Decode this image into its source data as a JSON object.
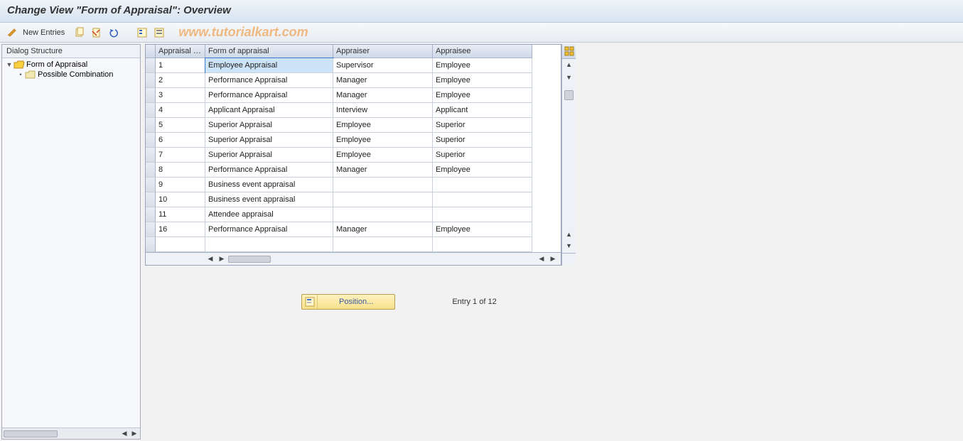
{
  "title": "Change View \"Form of Appraisal\": Overview",
  "toolbar": {
    "new_entries_label": "New Entries"
  },
  "watermark": "www.tutorialkart.com",
  "tree": {
    "header": "Dialog Structure",
    "items": [
      {
        "label": "Form of Appraisal",
        "open": true
      },
      {
        "label": "Possible Combination",
        "open": false
      }
    ]
  },
  "grid": {
    "columns": [
      "Appraisal f...",
      "Form of appraisal",
      "Appraiser",
      "Appraisee"
    ],
    "rows": [
      {
        "id": "1",
        "form": "Employee Appraisal",
        "appraiser": "Supervisor",
        "appraisee": "Employee"
      },
      {
        "id": "2",
        "form": "Performance Appraisal",
        "appraiser": "Manager",
        "appraisee": "Employee"
      },
      {
        "id": "3",
        "form": "Performance Appraisal",
        "appraiser": "Manager",
        "appraisee": "Employee"
      },
      {
        "id": "4",
        "form": "Applicant Appraisal",
        "appraiser": "Interview",
        "appraisee": "Applicant"
      },
      {
        "id": "5",
        "form": "Superior Appraisal",
        "appraiser": "Employee",
        "appraisee": "Superior"
      },
      {
        "id": "6",
        "form": "Superior Appraisal",
        "appraiser": "Employee",
        "appraisee": "Superior"
      },
      {
        "id": "7",
        "form": "Superior Appraisal",
        "appraiser": "Employee",
        "appraisee": "Superior"
      },
      {
        "id": "8",
        "form": "Performance Appraisal",
        "appraiser": "Manager",
        "appraisee": "Employee"
      },
      {
        "id": "9",
        "form": "Business event appraisal",
        "appraiser": "",
        "appraisee": ""
      },
      {
        "id": "10",
        "form": "Business event appraisal",
        "appraiser": "",
        "appraisee": ""
      },
      {
        "id": "11",
        "form": "Attendee appraisal",
        "appraiser": "",
        "appraisee": ""
      },
      {
        "id": "16",
        "form": "Performance Appraisal",
        "appraiser": "Manager",
        "appraisee": "Employee"
      }
    ],
    "selected_row": 0,
    "selected_col": "form"
  },
  "footer": {
    "position_label": "Position...",
    "entry_text": "Entry 1 of 12"
  }
}
